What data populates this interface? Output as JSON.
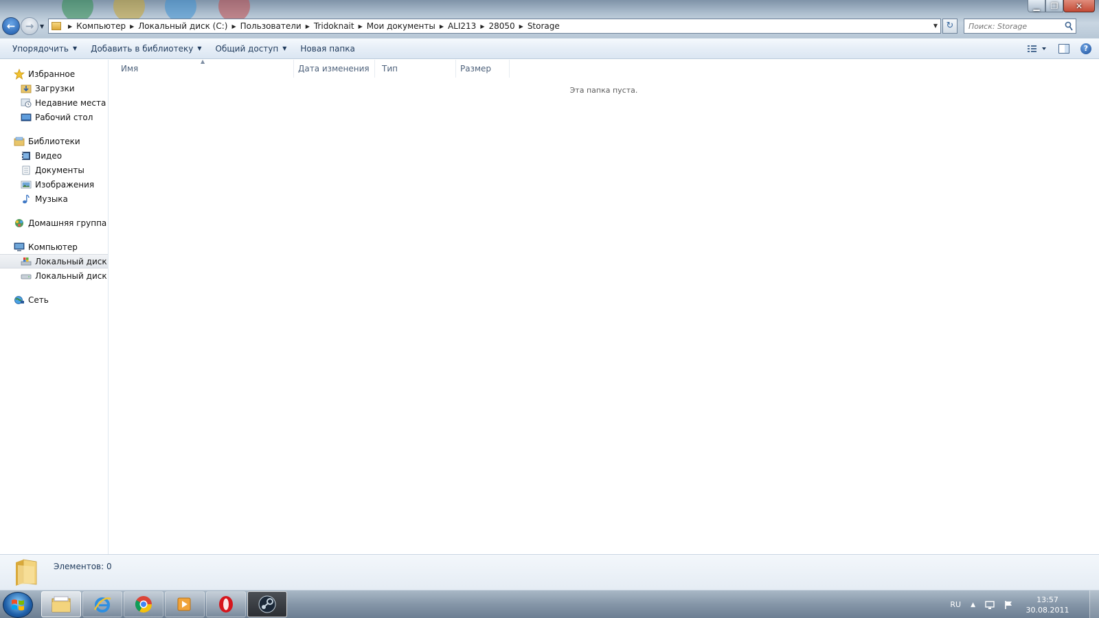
{
  "window": {
    "controls": {
      "minimize": "▁",
      "maximize": "❐",
      "close": "✕"
    }
  },
  "address_bar": {
    "breadcrumbs": [
      "Компьютер",
      "Локальный диск (C:)",
      "Пользователи",
      "Tridoknait",
      "Мои документы",
      "ALI213",
      "28050",
      "Storage"
    ]
  },
  "search": {
    "placeholder": "Поиск: Storage"
  },
  "toolbar": {
    "organize": "Упорядочить",
    "add_to_library": "Добавить в библиотеку",
    "share": "Общий доступ",
    "new_folder": "Новая папка"
  },
  "nav": {
    "favorites": {
      "label": "Избранное",
      "items": [
        "Загрузки",
        "Недавние места",
        "Рабочий стол"
      ]
    },
    "libraries": {
      "label": "Библиотеки",
      "items": [
        "Видео",
        "Документы",
        "Изображения",
        "Музыка"
      ]
    },
    "homegroup": {
      "label": "Домашняя группа"
    },
    "computer": {
      "label": "Компьютер",
      "items": [
        "Локальный диск (C",
        "Локальный диск (D"
      ]
    },
    "network": {
      "label": "Сеть"
    }
  },
  "columns": {
    "name": "Имя",
    "date": "Дата изменения",
    "type": "Тип",
    "size": "Размер"
  },
  "content": {
    "empty_message": "Эта папка пуста."
  },
  "details": {
    "items_count": "Элементов: 0"
  },
  "taskbar": {
    "language": "RU",
    "time": "13:57",
    "date": "30.08.2011"
  },
  "colors": {
    "toolbar_text": "#1e395b",
    "header_text": "#4c607a",
    "address_border": "#6d8299"
  }
}
